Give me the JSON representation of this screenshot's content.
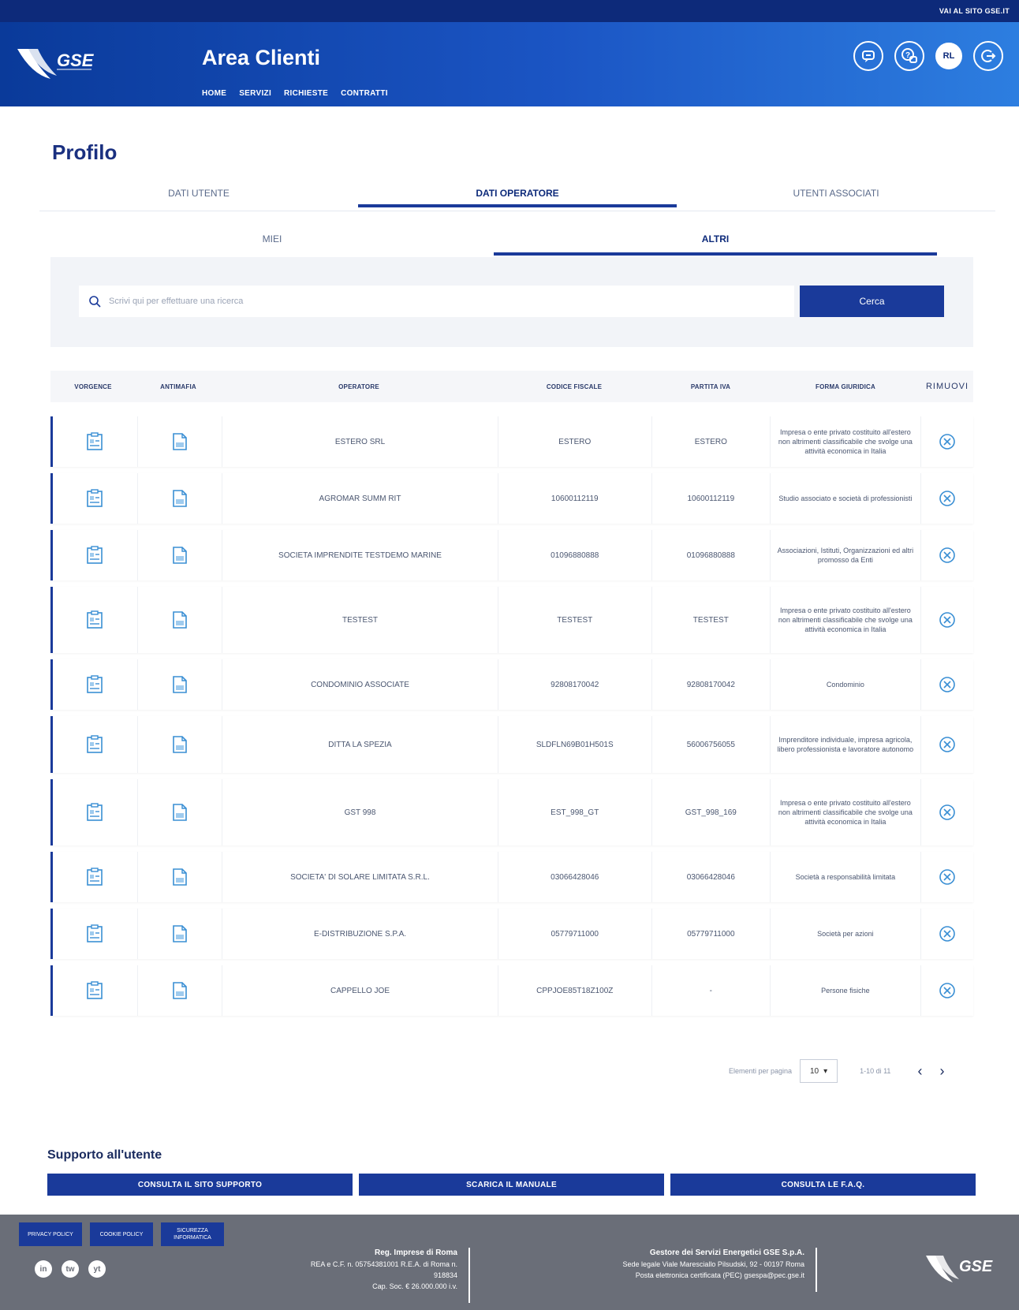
{
  "topbar": {
    "site_link": "VAI AL SITO GSE.IT"
  },
  "header": {
    "logo_text": "GSE",
    "app_title": "Area Clienti",
    "nav": [
      "HOME",
      "SERVIZI",
      "RICHIESTE",
      "CONTRATTI"
    ],
    "avatar_initials": "RL"
  },
  "page": {
    "title": "Profilo"
  },
  "tabs": [
    "DATI UTENTE",
    "DATI OPERATORE",
    "UTENTI ASSOCIATI"
  ],
  "subtabs": [
    "MIEI",
    "ALTRI"
  ],
  "search": {
    "placeholder": "Scrivi qui per effettuare una ricerca",
    "button": "Cerca"
  },
  "table": {
    "headers": [
      "VORGENCE",
      "ANTIMAFIA",
      "OPERATORE",
      "CODICE FISCALE",
      "PARTITA IVA",
      "FORMA GIURIDICA",
      "RIMUOVI"
    ],
    "rows": [
      {
        "operatore": "ESTERO SRL",
        "cf": "ESTERO",
        "piva": "ESTERO",
        "forma": "Impresa o ente privato costituito all'estero non altrimenti classificabile che svolge una attività economica in Italia"
      },
      {
        "operatore": "AGROMAR SUMM RIT",
        "cf": "10600112119",
        "piva": "10600112119",
        "forma": "Studio associato e società di professionisti"
      },
      {
        "operatore": "SOCIETA IMPRENDITE TESTDEMO MARINE",
        "cf": "01096880888",
        "piva": "01096880888",
        "forma": "Associazioni, Istituti, Organizzazioni ed altri promosso da Enti"
      },
      {
        "operatore": "TESTEST",
        "cf": "TESTEST",
        "piva": "TESTEST",
        "forma": "Impresa o ente privato costituito all'estero non altrimenti classificabile che svolge una attività economica in Italia"
      },
      {
        "operatore": "CONDOMINIO ASSOCIATE",
        "cf": "92808170042",
        "piva": "92808170042",
        "forma": "Condominio"
      },
      {
        "operatore": "DITTA LA SPEZIA",
        "cf": "SLDFLN69B01H501S",
        "piva": "56006756055",
        "forma": "Imprenditore individuale, impresa agricola, libero professionista e lavoratore autonomo"
      },
      {
        "operatore": "GST 998",
        "cf": "EST_998_GT",
        "piva": "GST_998_169",
        "forma": "Impresa o ente privato costituito all'estero non altrimenti classificabile che svolge una attività economica in Italia"
      },
      {
        "operatore": "SOCIETA' DI SOLARE LIMITATA S.R.L.",
        "cf": "03066428046",
        "piva": "03066428046",
        "forma": "Società a responsabilità limitata"
      },
      {
        "operatore": "E-DISTRIBUZIONE S.P.A.",
        "cf": "05779711000",
        "piva": "05779711000",
        "forma": "Società per azioni"
      },
      {
        "operatore": "CAPPELLO JOE",
        "cf": "CPPJOE85T18Z100Z",
        "piva": "-",
        "forma": "Persone fisiche"
      }
    ]
  },
  "pagination": {
    "label": "Elementi per pagina",
    "page_size": "10",
    "range": "1-10 di 11"
  },
  "support": {
    "title": "Supporto all'utente",
    "buttons": [
      "CONSULTA IL SITO SUPPORTO",
      "SCARICA IL MANUALE",
      "CONSULTA LE F.A.Q."
    ]
  },
  "footer": {
    "links": [
      "PRIVACY POLICY",
      "COOKIE POLICY",
      "SICUREZZA INFORMATICA"
    ],
    "social": [
      "in",
      "tw",
      "yt"
    ],
    "registro_title": "Reg. Imprese di Roma",
    "registro_lines": [
      "REA e C.F. n. 05754381001 R.E.A. di Roma n.",
      "918834",
      "Cap. Soc. € 26.000.000 i.v."
    ],
    "company_title": "Gestore dei Servizi Energetici GSE S.p.A.",
    "company_lines": [
      "Sede legale Viale Maresciallo Pilsudski, 92 - 00197 Roma",
      "Posta elettronica certificata (PEC) gsespa@pec.gse.it"
    ]
  }
}
